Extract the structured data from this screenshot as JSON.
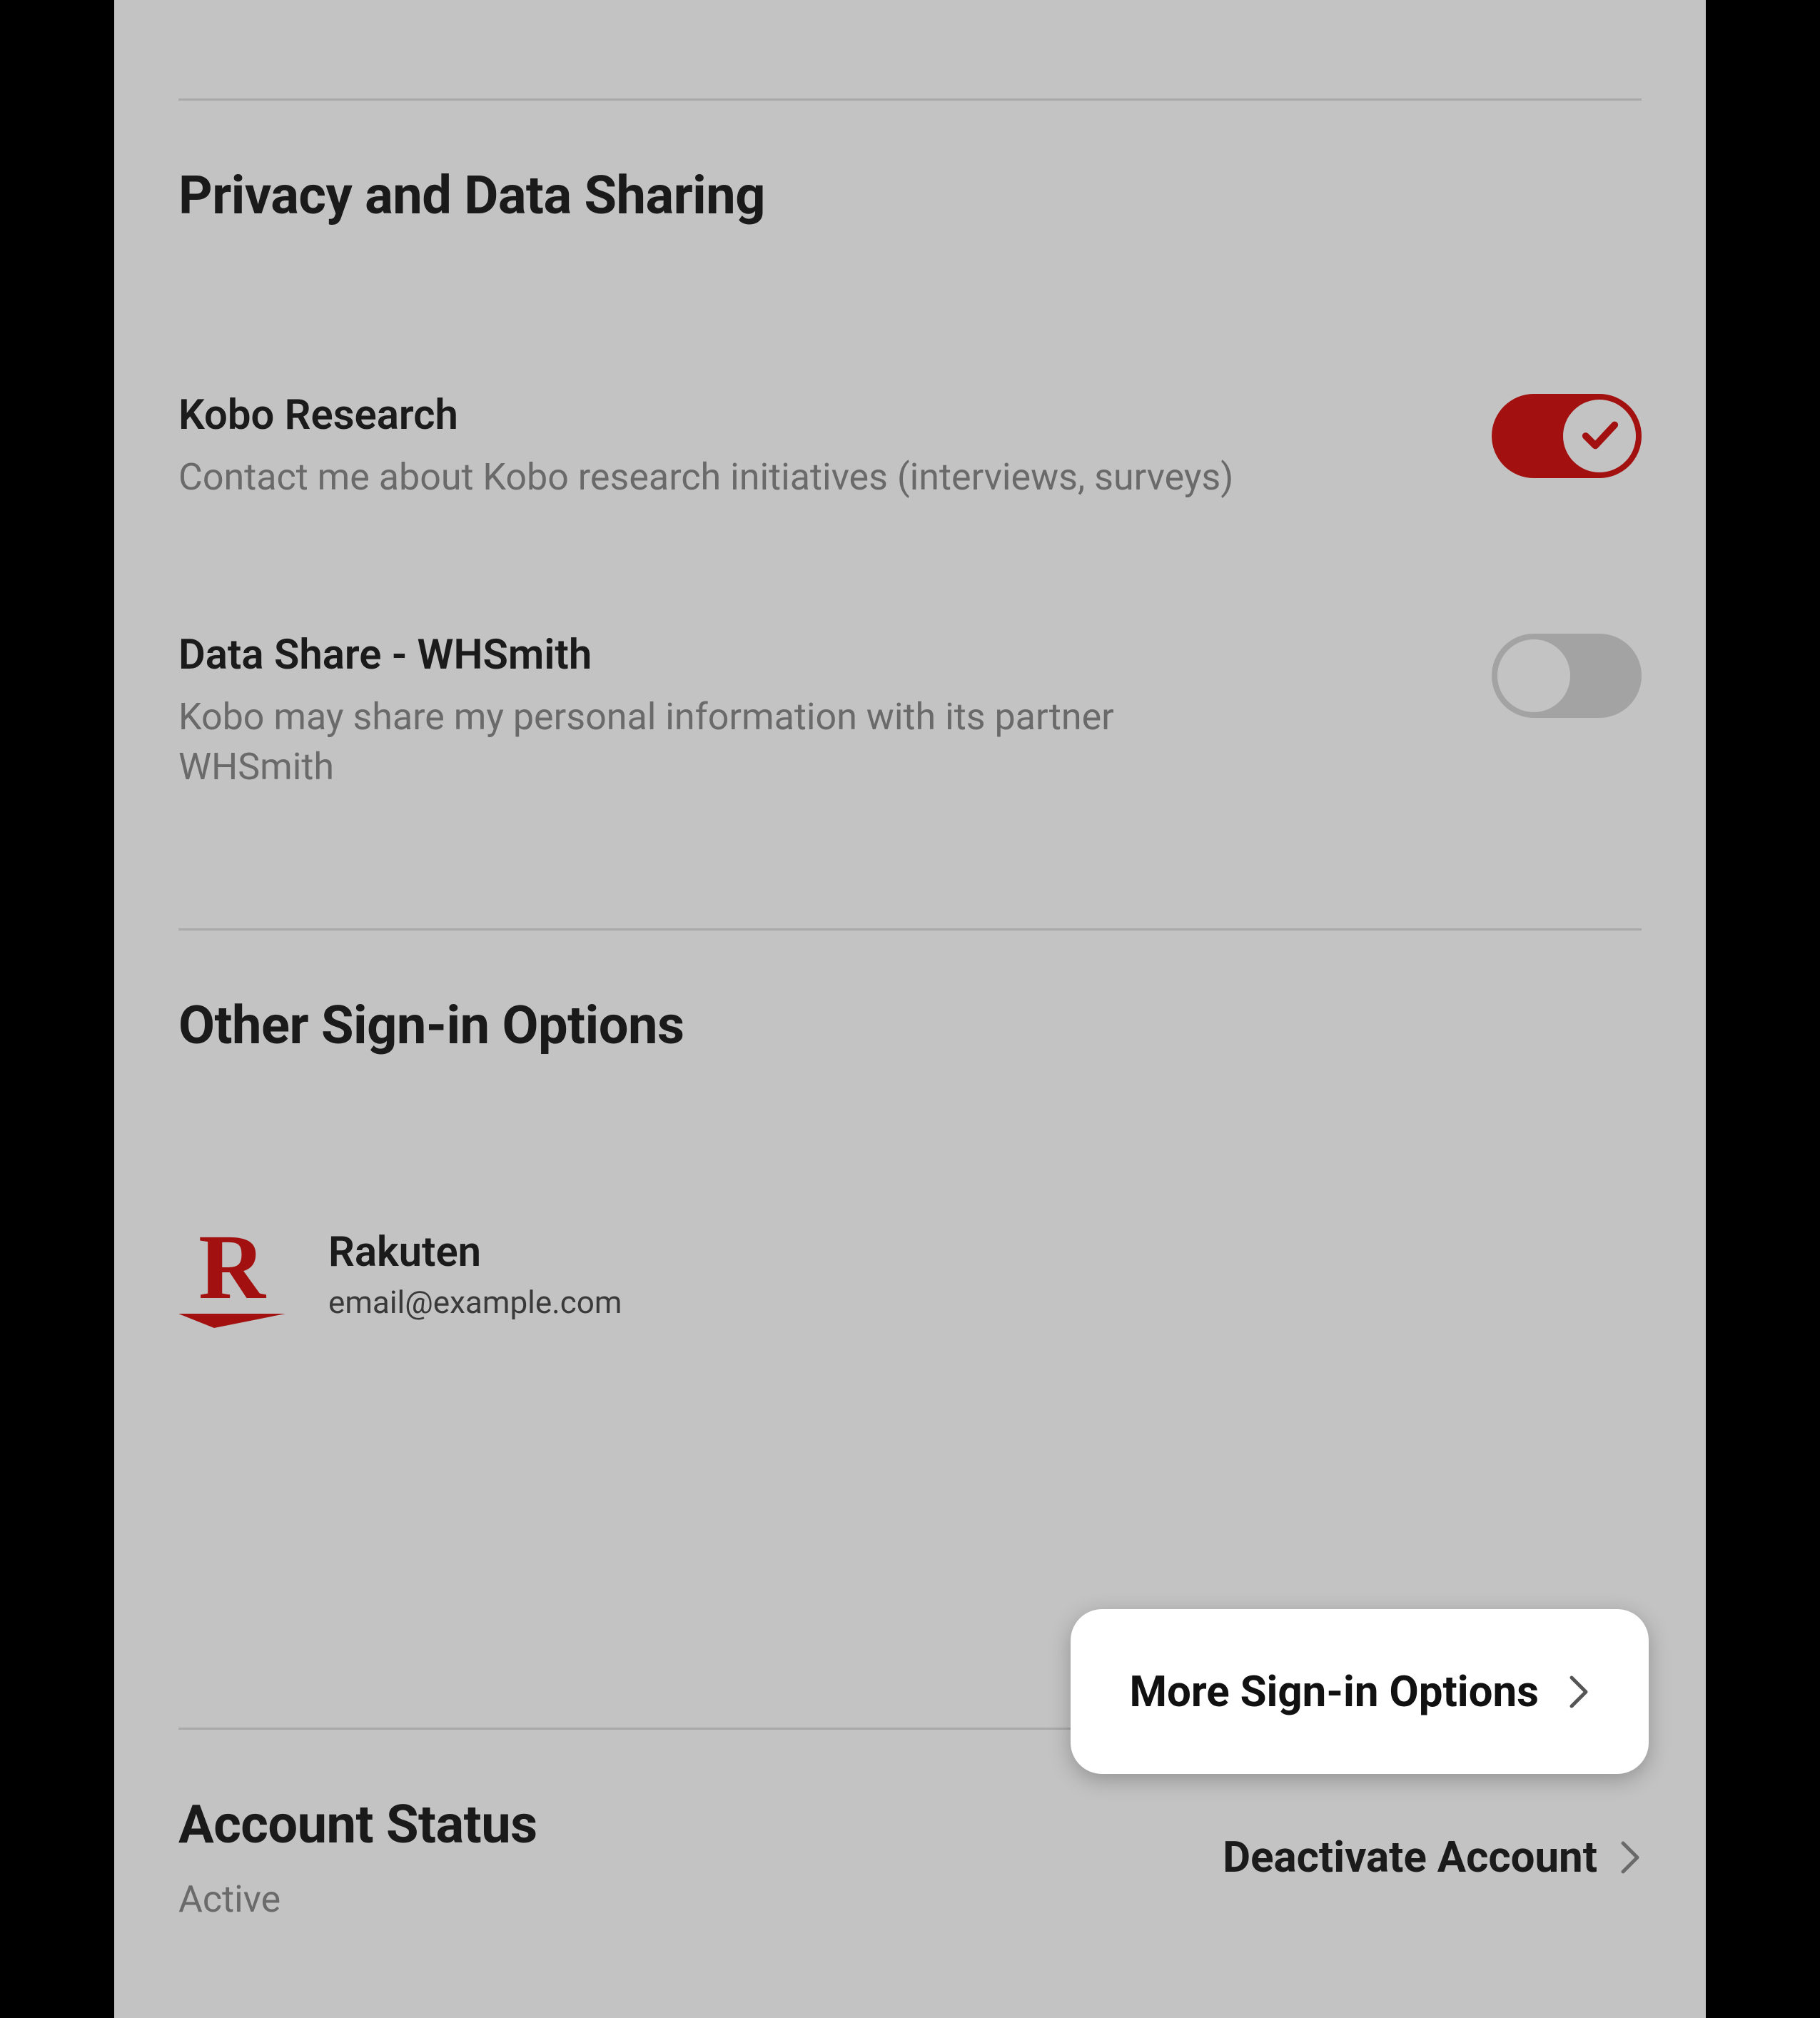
{
  "sections": {
    "privacy": {
      "title": "Privacy and Data Sharing",
      "items": [
        {
          "title": "Kobo Research",
          "desc": "Contact me about Kobo research initiatives (interviews, surveys)",
          "enabled": true
        },
        {
          "title": "Data Share - WHSmith",
          "desc": "Kobo may share my personal information with its partner WHSmith",
          "enabled": false
        }
      ]
    },
    "signin": {
      "title": "Other Sign-in Options",
      "provider": {
        "name": "Rakuten",
        "email": "email@example.com"
      },
      "more_label": "More Sign-in Options"
    },
    "status": {
      "title": "Account Status",
      "value": "Active",
      "deactivate_label": "Deactivate Account"
    }
  },
  "colors": {
    "accent": "#a2100f",
    "panel_bg": "#c3c3c3"
  }
}
